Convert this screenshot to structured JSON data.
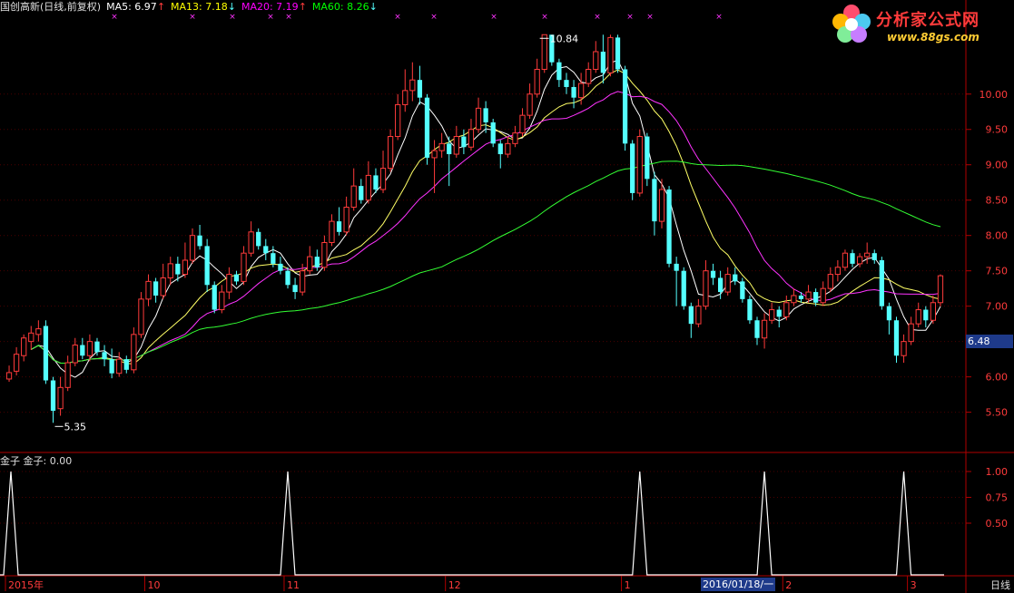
{
  "header": {
    "stock_name": "国创高新(日线,前复权)",
    "ma5": {
      "label": "MA5: 6.97",
      "arrow": "↑",
      "color": "#ffffff"
    },
    "ma13": {
      "label": "MA13: 7.18",
      "arrow": "↓",
      "color": "#ffff00"
    },
    "ma20": {
      "label": "MA20: 7.19",
      "arrow": "↑",
      "color": "#ff00ff"
    },
    "ma60": {
      "label": "MA60: 8.26",
      "arrow": "↓",
      "color": "#00ff00"
    }
  },
  "logo": {
    "title": "分析家公式网",
    "url": "www.88gs.com"
  },
  "price_axis": {
    "ticks": [
      "10.00",
      "9.50",
      "9.00",
      "8.50",
      "8.00",
      "7.50",
      "7.00",
      "6.50",
      "6.00",
      "5.50"
    ],
    "current_price": "6.48"
  },
  "annotations": {
    "high": "10.84",
    "low": "5.35"
  },
  "indicator": {
    "title": "金子",
    "value_label": "金子: 0.00",
    "ticks": [
      "1.00",
      "0.75",
      "0.50"
    ]
  },
  "time_axis": {
    "labels": [
      "2015年",
      "10",
      "11",
      "12",
      "1",
      "2",
      "3"
    ],
    "cursor_date": "2016/01/18/一",
    "period": "日线"
  },
  "colors": {
    "up": "#ff3b3b",
    "down": "#54ffff",
    "grid": "#6e0000",
    "axis": "#b00000"
  },
  "chart_data": [
    {
      "type": "candlestick",
      "title": "国创高新(日线,前复权)",
      "y_range": [
        5.2,
        11.1
      ],
      "y_ticks": [
        5.5,
        6.0,
        6.5,
        7.0,
        7.5,
        8.0,
        8.5,
        9.0,
        9.5,
        10.0
      ],
      "candles": [
        [
          5.97,
          6.06,
          5.93,
          6.16
        ],
        [
          6.08,
          6.32,
          6.02,
          6.42
        ],
        [
          6.3,
          6.55,
          6.22,
          6.6
        ],
        [
          6.5,
          6.62,
          6.38,
          6.72
        ],
        [
          6.6,
          6.68,
          6.5,
          6.8
        ],
        [
          6.72,
          5.95,
          5.9,
          6.8
        ],
        [
          5.95,
          5.52,
          5.35,
          6.0
        ],
        [
          5.55,
          5.85,
          5.45,
          6.0
        ],
        [
          5.85,
          6.2,
          5.8,
          6.3
        ],
        [
          6.2,
          6.45,
          6.15,
          6.55
        ],
        [
          6.45,
          6.3,
          6.25,
          6.55
        ],
        [
          6.3,
          6.5,
          6.22,
          6.6
        ],
        [
          6.5,
          6.35,
          6.3,
          6.55
        ],
        [
          6.35,
          6.25,
          6.15,
          6.45
        ],
        [
          6.25,
          6.05,
          5.98,
          6.4
        ],
        [
          6.05,
          6.25,
          6.0,
          6.35
        ],
        [
          6.25,
          6.1,
          6.05,
          6.3
        ],
        [
          6.1,
          6.6,
          6.05,
          6.7
        ],
        [
          6.6,
          7.1,
          6.55,
          7.2
        ],
        [
          7.1,
          7.35,
          7.0,
          7.45
        ],
        [
          7.35,
          7.15,
          7.05,
          7.4
        ],
        [
          7.15,
          7.4,
          7.1,
          7.6
        ],
        [
          7.4,
          7.6,
          7.3,
          7.7
        ],
        [
          7.6,
          7.45,
          7.35,
          7.7
        ],
        [
          7.45,
          7.65,
          7.4,
          7.9
        ],
        [
          7.65,
          8.0,
          7.6,
          8.1
        ],
        [
          8.0,
          7.85,
          7.8,
          8.15
        ],
        [
          7.85,
          7.3,
          7.2,
          7.95
        ],
        [
          7.3,
          6.95,
          6.9,
          7.35
        ],
        [
          6.95,
          7.2,
          6.9,
          7.3
        ],
        [
          7.2,
          7.45,
          7.1,
          7.55
        ],
        [
          7.45,
          7.35,
          7.3,
          7.5
        ],
        [
          7.35,
          7.75,
          7.3,
          7.85
        ],
        [
          7.75,
          8.05,
          7.7,
          8.2
        ],
        [
          8.05,
          7.85,
          7.8,
          8.1
        ],
        [
          7.85,
          7.75,
          7.65,
          7.95
        ],
        [
          7.75,
          7.6,
          7.55,
          7.85
        ],
        [
          7.6,
          7.5,
          7.45,
          7.7
        ],
        [
          7.5,
          7.3,
          7.25,
          7.55
        ],
        [
          7.3,
          7.2,
          7.1,
          7.4
        ],
        [
          7.2,
          7.5,
          7.15,
          7.6
        ],
        [
          7.5,
          7.7,
          7.45,
          7.85
        ],
        [
          7.7,
          7.55,
          7.5,
          7.8
        ],
        [
          7.55,
          7.9,
          7.5,
          8.0
        ],
        [
          7.9,
          8.2,
          7.85,
          8.3
        ],
        [
          8.2,
          8.05,
          8.0,
          8.4
        ],
        [
          8.05,
          8.4,
          8.0,
          8.55
        ],
        [
          8.4,
          8.7,
          8.35,
          8.95
        ],
        [
          8.7,
          8.5,
          8.45,
          8.8
        ],
        [
          8.5,
          8.85,
          8.45,
          9.05
        ],
        [
          8.85,
          8.65,
          8.6,
          8.95
        ],
        [
          8.65,
          8.95,
          8.6,
          9.2
        ],
        [
          8.95,
          9.4,
          8.9,
          9.5
        ],
        [
          9.4,
          9.85,
          9.35,
          10.0
        ],
        [
          9.85,
          10.05,
          9.75,
          10.35
        ],
        [
          10.05,
          10.2,
          9.9,
          10.45
        ],
        [
          10.2,
          9.95,
          9.85,
          10.4
        ],
        [
          9.95,
          9.1,
          9.0,
          10.0
        ],
        [
          9.1,
          9.2,
          8.6,
          9.35
        ],
        [
          9.2,
          9.3,
          9.1,
          9.45
        ],
        [
          9.3,
          9.15,
          8.7,
          9.4
        ],
        [
          9.15,
          9.4,
          9.1,
          9.55
        ],
        [
          9.4,
          9.25,
          9.15,
          9.5
        ],
        [
          9.25,
          9.5,
          9.2,
          9.65
        ],
        [
          9.5,
          9.8,
          9.45,
          9.95
        ],
        [
          9.8,
          9.6,
          9.45,
          9.9
        ],
        [
          9.6,
          9.3,
          9.25,
          9.65
        ],
        [
          9.3,
          9.15,
          8.95,
          9.35
        ],
        [
          9.15,
          9.3,
          9.1,
          9.4
        ],
        [
          9.3,
          9.45,
          9.25,
          9.55
        ],
        [
          9.45,
          9.7,
          9.4,
          9.8
        ],
        [
          9.7,
          10.0,
          9.65,
          10.15
        ],
        [
          10.0,
          10.35,
          9.95,
          10.5
        ],
        [
          10.35,
          10.84,
          10.3,
          10.84
        ],
        [
          10.84,
          10.45,
          10.4,
          10.84
        ],
        [
          10.45,
          10.2,
          10.1,
          10.5
        ],
        [
          10.2,
          10.1,
          10.0,
          10.3
        ],
        [
          10.1,
          9.95,
          9.8,
          10.2
        ],
        [
          9.95,
          10.15,
          9.85,
          10.3
        ],
        [
          10.15,
          10.35,
          10.1,
          10.45
        ],
        [
          10.35,
          10.6,
          10.3,
          10.75
        ],
        [
          10.6,
          10.3,
          10.15,
          10.84
        ],
        [
          10.3,
          10.8,
          10.25,
          10.84
        ],
        [
          10.8,
          10.35,
          10.3,
          10.84
        ],
        [
          10.35,
          9.3,
          9.2,
          10.4
        ],
        [
          9.3,
          8.6,
          8.5,
          9.35
        ],
        [
          8.6,
          9.4,
          8.55,
          9.5
        ],
        [
          9.4,
          8.8,
          8.7,
          9.45
        ],
        [
          8.8,
          8.2,
          8.0,
          8.9
        ],
        [
          8.2,
          8.65,
          8.1,
          8.8
        ],
        [
          8.65,
          7.6,
          7.55,
          8.7
        ],
        [
          7.6,
          7.5,
          7.0,
          7.7
        ],
        [
          7.5,
          7.0,
          6.95,
          7.55
        ],
        [
          7.0,
          6.75,
          6.55,
          7.05
        ],
        [
          6.75,
          7.0,
          6.7,
          7.1
        ],
        [
          7.0,
          7.5,
          6.95,
          7.65
        ],
        [
          7.5,
          7.4,
          7.3,
          7.6
        ],
        [
          7.4,
          7.2,
          7.1,
          7.5
        ],
        [
          7.2,
          7.45,
          7.15,
          7.55
        ],
        [
          7.45,
          7.35,
          7.3,
          7.55
        ],
        [
          7.35,
          7.1,
          7.05,
          7.4
        ],
        [
          7.1,
          6.8,
          6.75,
          7.15
        ],
        [
          6.8,
          6.55,
          6.45,
          6.85
        ],
        [
          6.55,
          6.8,
          6.4,
          6.9
        ],
        [
          6.8,
          6.95,
          6.75,
          7.05
        ],
        [
          6.95,
          6.85,
          6.7,
          7.0
        ],
        [
          6.85,
          7.05,
          6.8,
          7.15
        ],
        [
          7.05,
          7.15,
          7.0,
          7.25
        ],
        [
          7.15,
          7.1,
          7.05,
          7.2
        ],
        [
          7.1,
          7.2,
          7.05,
          7.3
        ],
        [
          7.2,
          7.05,
          7.0,
          7.25
        ],
        [
          7.05,
          7.25,
          7.0,
          7.35
        ],
        [
          7.25,
          7.45,
          7.2,
          7.55
        ],
        [
          7.45,
          7.55,
          7.35,
          7.65
        ],
        [
          7.55,
          7.75,
          7.5,
          7.8
        ],
        [
          7.75,
          7.6,
          7.55,
          7.8
        ],
        [
          7.6,
          7.7,
          7.55,
          7.75
        ],
        [
          7.7,
          7.75,
          7.6,
          7.9
        ],
        [
          7.75,
          7.65,
          7.6,
          7.8
        ],
        [
          7.65,
          7.0,
          6.95,
          7.7
        ],
        [
          7.0,
          6.8,
          6.6,
          7.05
        ],
        [
          6.8,
          6.3,
          6.2,
          6.85
        ],
        [
          6.3,
          6.5,
          6.2,
          6.6
        ],
        [
          6.5,
          6.75,
          6.45,
          6.85
        ],
        [
          6.75,
          6.95,
          6.7,
          7.05
        ],
        [
          6.95,
          6.8,
          6.7,
          7.0
        ],
        [
          6.8,
          7.05,
          6.75,
          7.15
        ],
        [
          7.05,
          7.43,
          7.0,
          7.45
        ]
      ],
      "ma_overlays": [
        "MA5",
        "MA13",
        "MA20",
        "MA60"
      ],
      "annotations": [
        {
          "label": "10.84",
          "type": "high"
        },
        {
          "label": "5.35",
          "type": "low"
        }
      ]
    },
    {
      "type": "line",
      "title": "金子",
      "y_range": [
        0,
        1
      ],
      "y_ticks": [
        0.5,
        0.75,
        1.0
      ],
      "spikes_at_candle": [
        0,
        38,
        86,
        103,
        122
      ],
      "values_note": "value 1.00 at spike candles, 0 elsewhere"
    }
  ]
}
